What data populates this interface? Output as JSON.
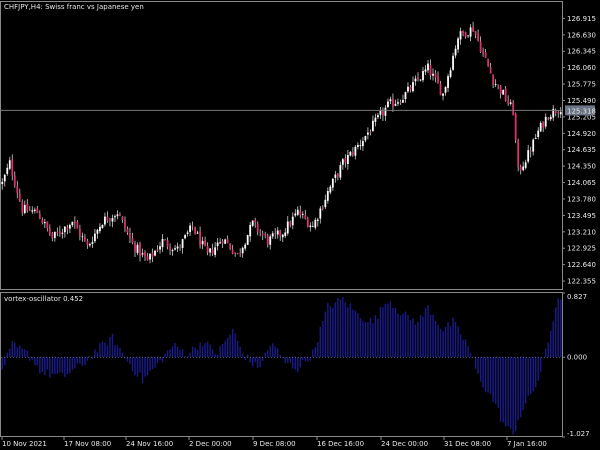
{
  "header": {
    "title": "CHFJPY,H4:  Swiss franc vs Japanese yen"
  },
  "indicator": {
    "title": "vortex-oscillator 0.452"
  },
  "colors": {
    "background": "#000000",
    "frame": "#8a8a8a",
    "bull_candle": "#ffffff",
    "bear_candle": "#d8336a",
    "wick": "#d0d0d0",
    "osc_bar": "#1a1a8c",
    "zero_line": "#808080",
    "current_price_line": "#7a7a7a",
    "current_price_box": "#6b7484",
    "text": "#e8e8e8"
  },
  "chart_data": [
    {
      "type": "candlestick",
      "title": "CHFJPY,H4:  Swiss franc vs Japanese yen",
      "current_price": 125.318,
      "current_price_label": "125.318",
      "ylim": [
        122.2,
        127.2
      ],
      "y_ticks": [
        126.915,
        126.63,
        126.345,
        126.06,
        125.775,
        125.49,
        125.205,
        124.92,
        124.635,
        124.35,
        124.065,
        123.78,
        123.495,
        123.21,
        122.925,
        122.64,
        122.355
      ],
      "y_tick_labels": [
        "126.915",
        "126.630",
        "126.345",
        "126.060",
        "125.775",
        "125.490",
        "125.205",
        "124.920",
        "124.635",
        "124.350",
        "124.065",
        "123.780",
        "123.495",
        "123.210",
        "122.925",
        "122.640",
        "122.355"
      ],
      "close_path": [
        [
          0,
          124.05
        ],
        [
          3,
          124.4
        ],
        [
          8,
          123.6
        ],
        [
          14,
          123.55
        ],
        [
          20,
          123.1
        ],
        [
          28,
          123.4
        ],
        [
          34,
          122.95
        ],
        [
          40,
          123.4
        ],
        [
          46,
          123.55
        ],
        [
          52,
          123.0
        ],
        [
          58,
          122.7
        ],
        [
          64,
          123.05
        ],
        [
          70,
          122.9
        ],
        [
          76,
          123.3
        ],
        [
          82,
          122.8
        ],
        [
          88,
          123.1
        ],
        [
          94,
          122.8
        ],
        [
          100,
          123.35
        ],
        [
          106,
          123.05
        ],
        [
          112,
          123.2
        ],
        [
          118,
          123.55
        ],
        [
          124,
          123.3
        ],
        [
          130,
          123.9
        ],
        [
          136,
          124.4
        ],
        [
          142,
          124.7
        ],
        [
          148,
          125.05
        ],
        [
          154,
          125.4
        ],
        [
          160,
          125.55
        ],
        [
          166,
          125.85
        ],
        [
          170,
          126.05
        ],
        [
          176,
          125.6
        ],
        [
          182,
          126.6
        ],
        [
          188,
          126.75
        ],
        [
          192,
          126.3
        ],
        [
          196,
          125.85
        ],
        [
          200,
          125.6
        ],
        [
          204,
          125.3
        ],
        [
          206,
          124.25
        ],
        [
          210,
          124.55
        ],
        [
          214,
          124.95
        ],
        [
          218,
          125.25
        ],
        [
          224,
          125.4
        ]
      ],
      "candle_count": 224
    },
    {
      "type": "bar",
      "title": "vortex-oscillator 0.452",
      "series": [
        {
          "name": "vortex-oscillator",
          "values_path": [
            [
              0,
              -0.15
            ],
            [
              4,
              0.15
            ],
            [
              10,
              0.05
            ],
            [
              16,
              -0.2
            ],
            [
              24,
              -0.25
            ],
            [
              32,
              -0.1
            ],
            [
              38,
              0.1
            ],
            [
              44,
              0.25
            ],
            [
              50,
              -0.05
            ],
            [
              56,
              -0.3
            ],
            [
              62,
              -0.1
            ],
            [
              68,
              0.15
            ],
            [
              74,
              0.05
            ],
            [
              80,
              0.2
            ],
            [
              86,
              0.05
            ],
            [
              92,
              0.35
            ],
            [
              96,
              0.05
            ],
            [
              102,
              -0.15
            ],
            [
              108,
              0.2
            ],
            [
              112,
              -0.05
            ],
            [
              118,
              -0.15
            ],
            [
              124,
              0.05
            ],
            [
              130,
              0.65
            ],
            [
              136,
              0.75
            ],
            [
              142,
              0.55
            ],
            [
              148,
              0.45
            ],
            [
              154,
              0.75
            ],
            [
              160,
              0.55
            ],
            [
              166,
              0.45
            ],
            [
              170,
              0.65
            ],
            [
              176,
              0.35
            ],
            [
              180,
              0.45
            ],
            [
              186,
              0.15
            ],
            [
              190,
              -0.25
            ],
            [
              196,
              -0.55
            ],
            [
              200,
              -0.85
            ],
            [
              204,
              -1.0
            ],
            [
              206,
              -0.8
            ],
            [
              210,
              -0.55
            ],
            [
              214,
              -0.3
            ],
            [
              218,
              0.2
            ],
            [
              222,
              0.8
            ],
            [
              224,
              0.6
            ]
          ]
        }
      ],
      "ylim": [
        -1.027,
        0.827
      ],
      "y_ticks": [
        0.827,
        0.0,
        -1.027
      ],
      "y_tick_labels": [
        "0.827",
        "0.000",
        "-1.027"
      ]
    }
  ],
  "x_axis": {
    "tick_positions": [
      0,
      32,
      64,
      97,
      128,
      160,
      192,
      224
    ],
    "labels": [
      "10 Nov 2021",
      "17 Nov 08:00",
      "24 Nov 16:00",
      "2 Dec 00:00",
      "9 Dec 08:00",
      "16 Dec 16:00",
      "24 Dec 00:00",
      "31 Dec 08:00",
      "7 Jan 16:00"
    ]
  }
}
